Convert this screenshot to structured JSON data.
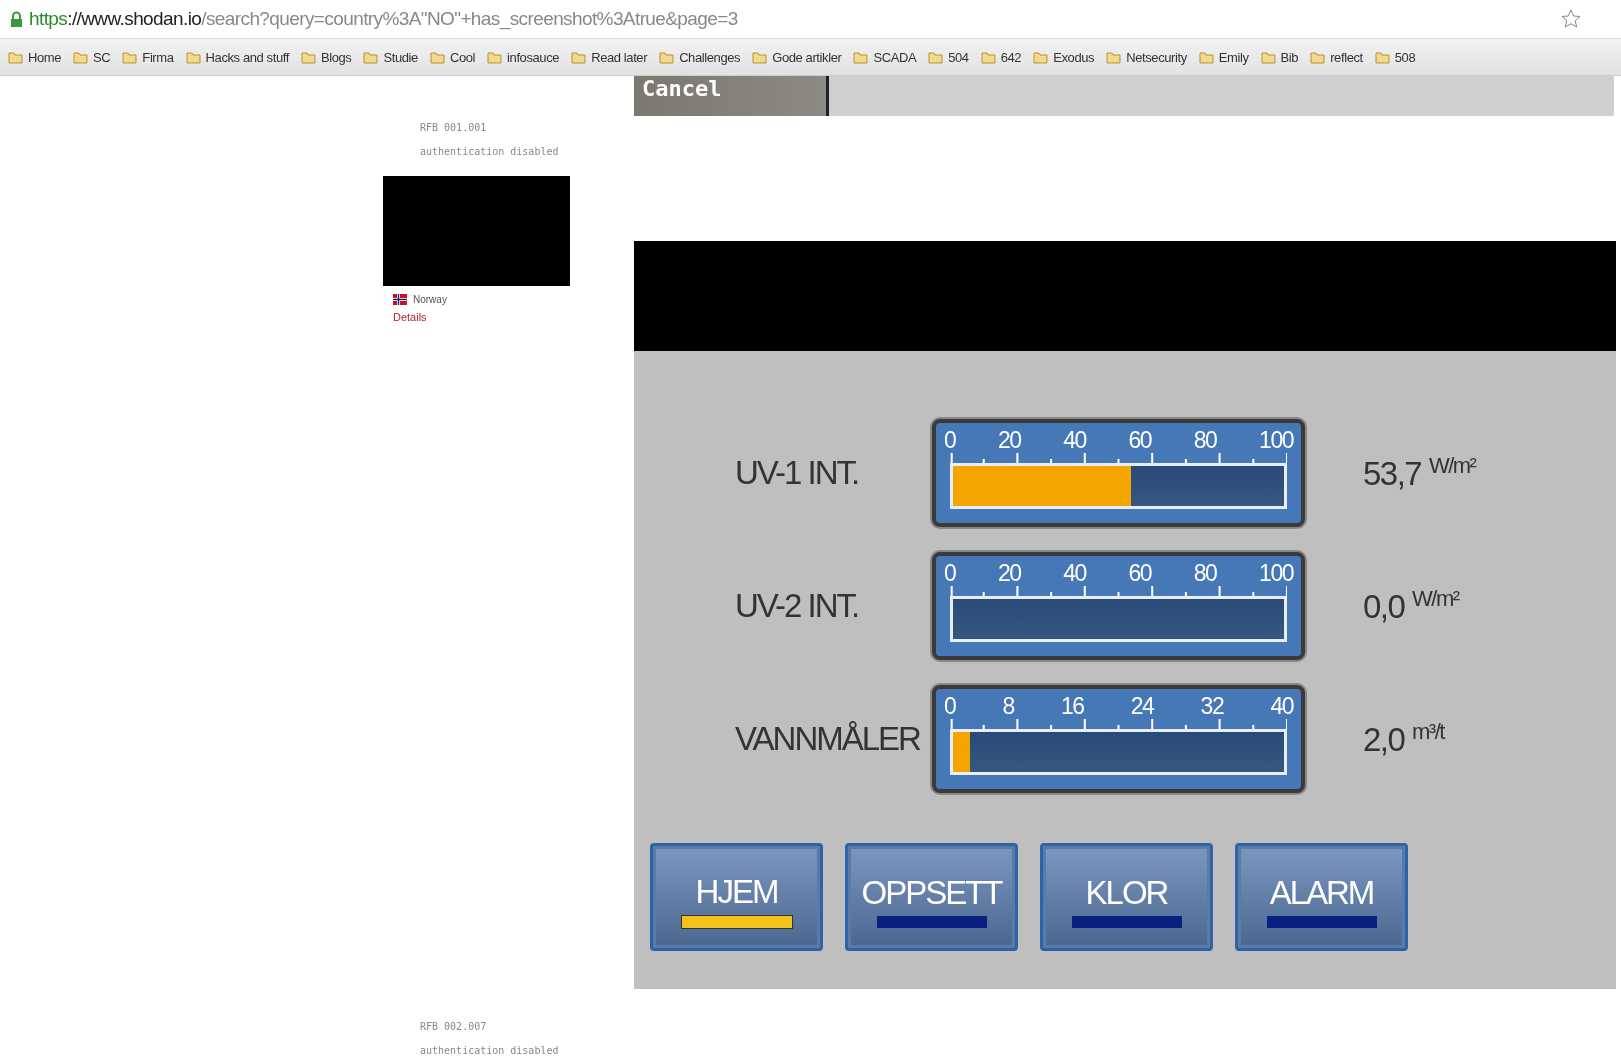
{
  "browser": {
    "url": {
      "scheme": "https",
      "host": "://www.shodan.io",
      "rest": "/search?query=country%3A\"NO\"+has_screenshot%3Atrue&page=3"
    },
    "bookmarks": [
      "Home",
      "SC",
      "Firma",
      "Hacks and stuff",
      "Blogs",
      "Studie",
      "Cool",
      "infosauce",
      "Read later",
      "Challenges",
      "Gode artikler",
      "SCADA",
      "504",
      "642",
      "Exodus",
      "Netsecurity",
      "Emily",
      "Bib",
      "reflect",
      "508"
    ]
  },
  "results": [
    {
      "protocol": "RFB 001.001",
      "auth": "authentication disabled",
      "country": "Norway",
      "link": "Details"
    },
    {
      "protocol": "RFB 002.007",
      "auth": "authentication disabled"
    }
  ],
  "prev_screenshot": {
    "button": "Cancel"
  },
  "hmi": {
    "meters": [
      {
        "label": "UV-1 INT.",
        "scale": [
          "0",
          "20",
          "40",
          "60",
          "80",
          "100"
        ],
        "level": 0.537,
        "value": "53,7",
        "unit": "W/m²"
      },
      {
        "label": "UV-2 INT.",
        "scale": [
          "0",
          "20",
          "40",
          "60",
          "80",
          "100"
        ],
        "level": 0.0,
        "value": "0,0",
        "unit": "W/m²"
      },
      {
        "label": "VANNMÅLER",
        "scale": [
          "0",
          "8",
          "16",
          "24",
          "32",
          "40"
        ],
        "level": 0.05,
        "value": "2,0",
        "unit": "m³/t"
      }
    ],
    "nav": [
      {
        "label": "HJEM",
        "selected": true
      },
      {
        "label": "OPPSETT",
        "selected": false
      },
      {
        "label": "KLOR",
        "selected": false
      },
      {
        "label": "ALARM",
        "selected": false
      }
    ]
  }
}
